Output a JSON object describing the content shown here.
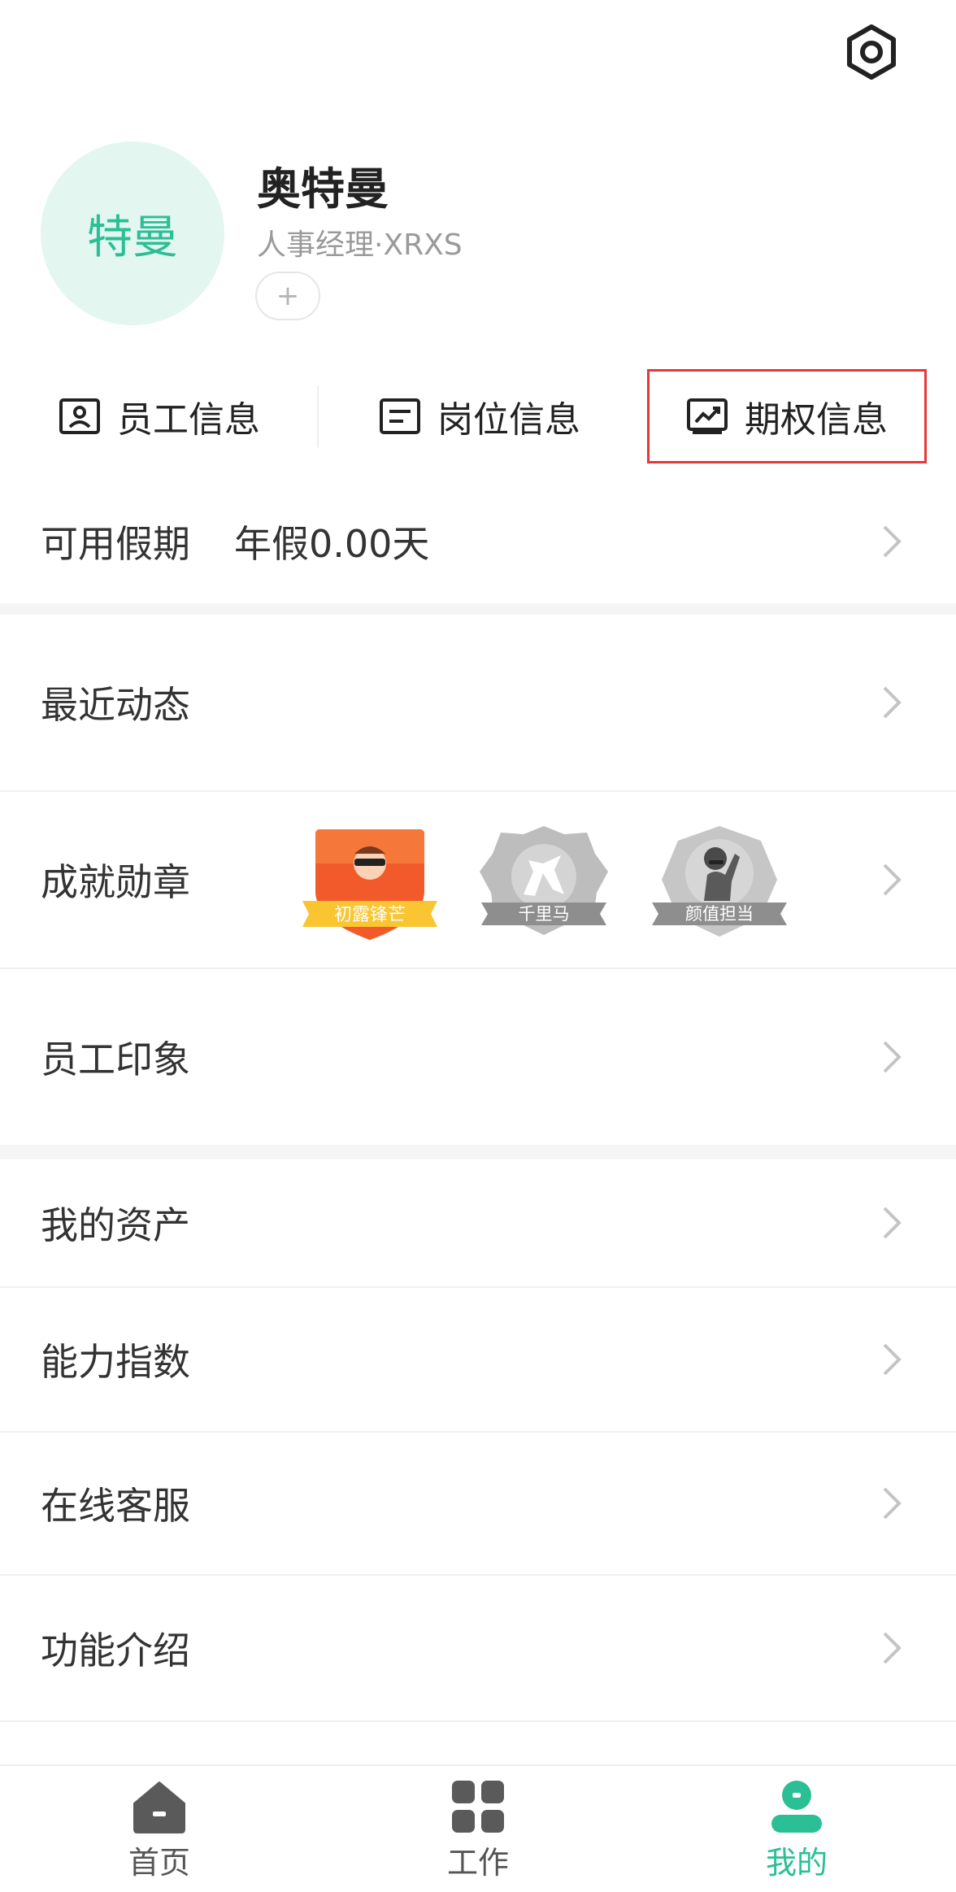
{
  "profile": {
    "avatar_text": "特曼",
    "name": "奥特曼",
    "role": "人事经理·XRXS",
    "add_tag": "+"
  },
  "quick_tabs": [
    {
      "label": "员工信息",
      "icon": "id-card-icon"
    },
    {
      "label": "岗位信息",
      "icon": "document-icon"
    },
    {
      "label": "期权信息",
      "icon": "chart-icon",
      "highlighted": true
    }
  ],
  "vacation": {
    "label": "可用假期",
    "value": "年假0.00天"
  },
  "menu_group1": [
    {
      "label": "最近动态"
    },
    {
      "label": "成就勋章"
    },
    {
      "label": "员工印象"
    }
  ],
  "badges": [
    {
      "label": "初露锋芒",
      "earned": true
    },
    {
      "label": "千里马",
      "earned": false
    },
    {
      "label": "颜值担当",
      "earned": false
    }
  ],
  "menu_group2": [
    {
      "label": "我的资产"
    },
    {
      "label": "能力指数"
    },
    {
      "label": "在线客服"
    },
    {
      "label": "功能介绍"
    }
  ],
  "tabbar": [
    {
      "label": "首页",
      "icon": "home-icon"
    },
    {
      "label": "工作",
      "icon": "grid-icon"
    },
    {
      "label": "我的",
      "icon": "person-icon",
      "active": true
    }
  ],
  "colors": {
    "accent": "#2bbf95",
    "highlight_border": "#e53935",
    "avatar_bg": "#e3f6f0"
  }
}
